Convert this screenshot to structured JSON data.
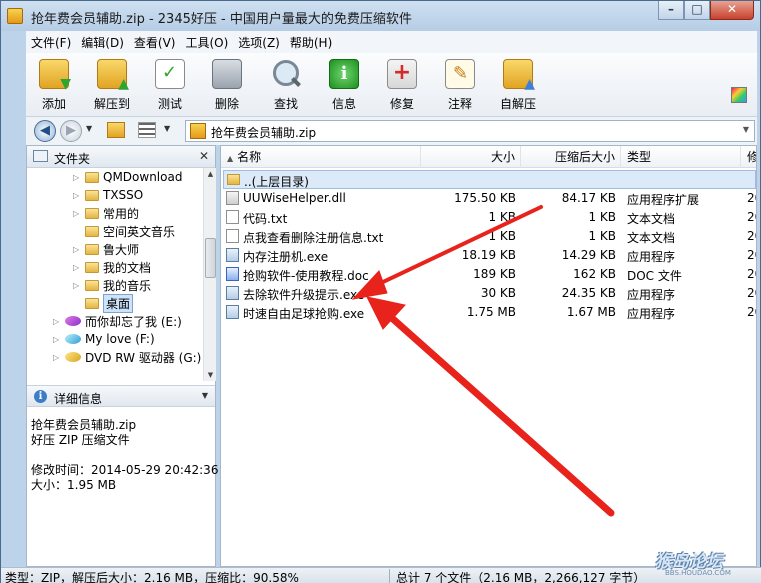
{
  "window": {
    "title": "抢年费会员辅助.zip - 2345好压 - 中国用户量最大的免费压缩软件"
  },
  "menu": [
    "文件(F)",
    "编辑(D)",
    "查看(V)",
    "工具(O)",
    "选项(Z)",
    "帮助(H)"
  ],
  "toolbar": [
    {
      "label": "添加",
      "icon": "add-archive-icon"
    },
    {
      "label": "解压到",
      "icon": "extract-icon"
    },
    {
      "label": "测试",
      "icon": "test-icon"
    },
    {
      "label": "删除",
      "icon": "delete-icon"
    },
    {
      "label": "查找",
      "icon": "find-icon"
    },
    {
      "label": "信息",
      "icon": "info-icon"
    },
    {
      "label": "修复",
      "icon": "repair-icon"
    },
    {
      "label": "注释",
      "icon": "comment-icon"
    },
    {
      "label": "自解压",
      "icon": "sfx-icon"
    }
  ],
  "address": {
    "path": "抢年费会员辅助.zip"
  },
  "folder_pane": {
    "title": "文件夹",
    "items": [
      {
        "label": "QMDownload",
        "type": "folder"
      },
      {
        "label": "TXSSO",
        "type": "folder"
      },
      {
        "label": "常用的",
        "type": "folder"
      },
      {
        "label": "空间英文音乐",
        "type": "folder"
      },
      {
        "label": "鲁大师",
        "type": "folder"
      },
      {
        "label": "我的文档",
        "type": "folder"
      },
      {
        "label": "我的音乐",
        "type": "folder"
      },
      {
        "label": "桌面",
        "type": "folder",
        "selected": true
      },
      {
        "label": "而你却忘了我 (E:)",
        "type": "drive"
      },
      {
        "label": "My love (F:)",
        "type": "drive"
      },
      {
        "label": "DVD RW 驱动器 (G:)",
        "type": "dvd"
      }
    ]
  },
  "details_pane": {
    "title": "详细信息",
    "filename": "抢年费会员辅助.zip",
    "filetype": "好压 ZIP 压缩文件",
    "modified": "修改时间：2014-05-29 20:42:36",
    "size": "大小：1.95 MB"
  },
  "file_list": {
    "columns": {
      "name": "名称",
      "size": "大小",
      "packed": "压缩后大小",
      "type": "类型",
      "modified": "修"
    },
    "parent": "..(上层目录)",
    "rows": [
      {
        "name": "UUWiseHelper.dll",
        "size": "175.50 KB",
        "packed": "84.17 KB",
        "type": "应用程序扩展",
        "modified": "20",
        "icon": "dll"
      },
      {
        "name": "代码.txt",
        "size": "1 KB",
        "packed": "1 KB",
        "type": "文本文档",
        "modified": "20",
        "icon": "txt"
      },
      {
        "name": "点我查看删除注册信息.txt",
        "size": "1 KB",
        "packed": "1 KB",
        "type": "文本文档",
        "modified": "20",
        "icon": "txt"
      },
      {
        "name": "内存注册机.exe",
        "size": "18.19 KB",
        "packed": "14.29 KB",
        "type": "应用程序",
        "modified": "20",
        "icon": "exe"
      },
      {
        "name": "抢购软件-使用教程.doc",
        "size": "189 KB",
        "packed": "162 KB",
        "type": "DOC 文件",
        "modified": "20",
        "icon": "doc"
      },
      {
        "name": "去除软件升级提示.exe",
        "size": "30 KB",
        "packed": "24.35 KB",
        "type": "应用程序",
        "modified": "20",
        "icon": "exe"
      },
      {
        "name": "时速自由足球抢购.exe",
        "size": "1.75 MB",
        "packed": "1.67 MB",
        "type": "应用程序",
        "modified": "20",
        "icon": "exe"
      }
    ]
  },
  "status": {
    "left": "类型：ZIP，解压后大小：2.16 MB，压缩比：90.58%",
    "right": "总计 7 个文件（2.16 MB，2,266,127 字节）"
  },
  "watermark": {
    "text": "猴岛论坛",
    "sub": "BBS.HOUDAO.COM"
  },
  "colors": {
    "selection": "#cde3fa",
    "annotation_arrow": "#e8231b"
  }
}
